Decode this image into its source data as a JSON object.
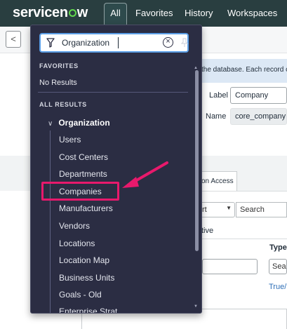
{
  "topbar": {
    "logo_pre": "servicen",
    "logo_post": "w",
    "nav_all": "All",
    "nav_favorites": "Favorites",
    "nav_history": "History",
    "nav_workspaces": "Workspaces"
  },
  "background_form": {
    "back_symbol": "<",
    "info_text": "the database. Each record c",
    "label_label": "Label",
    "label_value": "Company",
    "name_label": "Name",
    "name_value": "core_company",
    "tab_label": "on Access",
    "select_value": "rt",
    "search_placeholder": "Search",
    "active_text": "tive",
    "type_header": "Type",
    "type_input_value": "Sear",
    "link_text": "True/"
  },
  "menu": {
    "filter_value": "Organization",
    "favorites_title": "FAVORITES",
    "favorites_empty": "No Results",
    "all_results_title": "ALL RESULTS",
    "group_label": "Organization",
    "items": [
      {
        "label": "Users"
      },
      {
        "label": "Cost Centers"
      },
      {
        "label": "Departments"
      },
      {
        "label": "Companies"
      },
      {
        "label": "Manufacturers"
      },
      {
        "label": "Vendors"
      },
      {
        "label": "Locations"
      },
      {
        "label": "Location Map"
      },
      {
        "label": "Business Units"
      },
      {
        "label": "Goals - Old"
      },
      {
        "label": "Enterprise Strat"
      }
    ]
  },
  "colors": {
    "topbar": "#293e40",
    "panel": "#2b2d43",
    "highlight": "#e8196c",
    "filter_border": "#5a9ee6"
  },
  "icons": {
    "filter": "filter-icon",
    "clear": "clear-circle-x-icon",
    "pin": "pin-icon",
    "chevron": "chevron-down-icon",
    "back": "chevron-left-icon"
  }
}
